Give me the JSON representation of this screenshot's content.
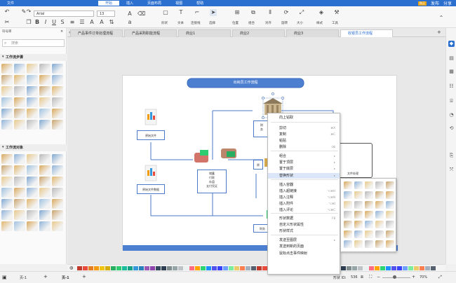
{
  "menubar": {
    "items": [
      "文件",
      "开始",
      "插入",
      "页面布局",
      "视图",
      "帮助"
    ],
    "active_index": 1,
    "right": {
      "badge": "购买",
      "share": "发布",
      "user": "分享"
    }
  },
  "toolbar": {
    "font_name": "Arial",
    "font_size": "13",
    "tools": [
      "形状",
      "文本",
      "连接线",
      "选择",
      "位置",
      "组合",
      "对齐",
      "旋转",
      "大小",
      "样式",
      "工具"
    ]
  },
  "left_panel": {
    "header": "符号库",
    "search_placeholder": "搜索",
    "section1": "工作流步骤",
    "section2": "工作流对象"
  },
  "tabs": [
    {
      "label": "产品事件订单处理流程"
    },
    {
      "label": "产品采购职能流程"
    },
    {
      "label": "商业1"
    },
    {
      "label": "商业2"
    },
    {
      "label": "商业3"
    },
    {
      "label": "收银员工作流程"
    }
  ],
  "active_tab": 5,
  "diagram": {
    "title": "出纳员工作流程",
    "box1": "原始文件",
    "box2": "原始文件数据",
    "mid_box": [
      "储蓄",
      "付款",
      "存盘",
      "支付凭证"
    ],
    "top_box": [
      "财",
      "务"
    ],
    "right_box": "原",
    "doc_box": "文件处理",
    "bottom_box": "财务"
  },
  "context_menu": {
    "items": [
      {
        "label": "向上钻取",
        "shortcut": ""
      },
      {
        "label": "剪切",
        "shortcut": "⌘X"
      },
      {
        "label": "复制",
        "shortcut": "⌘C"
      },
      {
        "label": "粘贴",
        "shortcut": ""
      },
      {
        "label": "删除",
        "shortcut": "⌫"
      },
      {
        "label": "组合",
        "shortcut": ""
      },
      {
        "label": "置于顶层",
        "shortcut": ""
      },
      {
        "label": "置于底层",
        "shortcut": ""
      },
      {
        "label": "替换形状",
        "shortcut": ""
      },
      {
        "label": "插入容器",
        "shortcut": ""
      },
      {
        "label": "插入超链接",
        "shortcut": "⌥⌘H"
      },
      {
        "label": "插入注释",
        "shortcut": "⌥⌘N"
      },
      {
        "label": "插入附件",
        "shortcut": "⌥⌘I"
      },
      {
        "label": "插入评论",
        "shortcut": "⌥⌘C"
      },
      {
        "label": "形状数据",
        "shortcut": "F8"
      },
      {
        "label": "自定义形状属性",
        "shortcut": ""
      },
      {
        "label": "形状样式",
        "shortcut": ""
      },
      {
        "label": "发送至图层",
        "shortcut": ""
      },
      {
        "label": "发送到新的页面",
        "shortcut": ""
      },
      {
        "label": "鼠标点击事件映射",
        "shortcut": ""
      }
    ],
    "highlight_index": 8
  },
  "status": {
    "page_selector": "页-1",
    "page_tab": "页-1",
    "shape_id_label": "形状 ID:",
    "shape_id": "536",
    "zoom": "70%"
  }
}
